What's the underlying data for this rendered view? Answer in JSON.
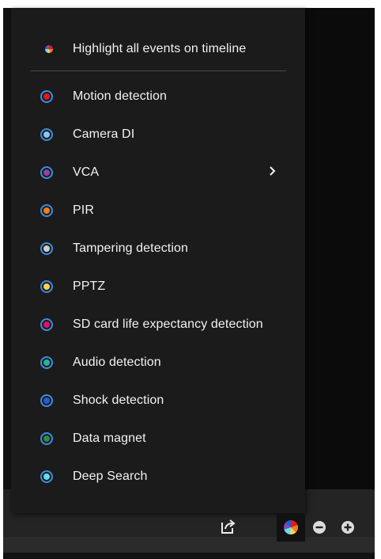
{
  "menu": {
    "highlight_label": "Highlight all events on timeline",
    "items": [
      {
        "label": "Motion detection",
        "color": "#e01b1b",
        "submenu": false
      },
      {
        "label": "Camera DI",
        "color": "#8fc6ea",
        "submenu": false
      },
      {
        "label": "VCA",
        "color": "#8e44ad",
        "submenu": true
      },
      {
        "label": "PIR",
        "color": "#f07f1a",
        "submenu": false
      },
      {
        "label": "Tampering detection",
        "color": "#cfcfcf",
        "submenu": false
      },
      {
        "label": "PPTZ",
        "color": "#f4d35e",
        "submenu": false
      },
      {
        "label": "SD card life expectancy detection",
        "color": "#e0106a",
        "submenu": false
      },
      {
        "label": "Audio detection",
        "color": "#1fb79a",
        "submenu": false
      },
      {
        "label": "Shock detection",
        "color": "#2b59d6",
        "submenu": false
      },
      {
        "label": "Data magnet",
        "color": "#2e8b4a",
        "submenu": false
      },
      {
        "label": "Deep Search",
        "color": "#5ee0f2",
        "submenu": false
      }
    ],
    "submenu_chevron": "›"
  },
  "toolbar": {
    "icons": [
      "export-icon",
      "event-color-pie-icon",
      "zoom-out-icon",
      "zoom-in-icon"
    ]
  },
  "colors": {
    "radio_ring": "#3b8de0",
    "menu_bg": "#1b1b1b",
    "toolbar_bg": "#242424"
  }
}
